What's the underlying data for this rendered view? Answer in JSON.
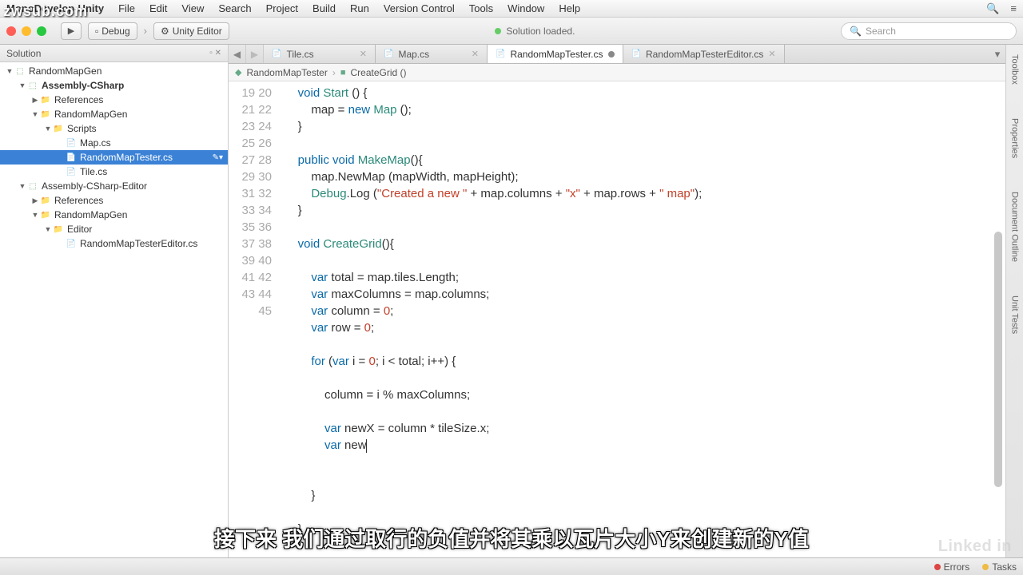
{
  "watermark": "zwsub.com",
  "menubar": {
    "title": "MonoDevelop-Unity",
    "items": [
      "File",
      "Edit",
      "View",
      "Search",
      "Project",
      "Build",
      "Run",
      "Version Control",
      "Tools",
      "Window",
      "Help"
    ]
  },
  "toolbar": {
    "debug": "Debug",
    "target": "Unity Editor",
    "status": "Solution loaded.",
    "search_placeholder": "Search"
  },
  "solution_panel": {
    "title": "Solution",
    "tree": [
      {
        "depth": 0,
        "tw": "▼",
        "icon": "proj",
        "label": "RandomMapGen"
      },
      {
        "depth": 1,
        "tw": "▼",
        "icon": "proj",
        "label": "Assembly-CSharp",
        "bold": true
      },
      {
        "depth": 2,
        "tw": "▶",
        "icon": "folder",
        "label": "References"
      },
      {
        "depth": 2,
        "tw": "▼",
        "icon": "folder",
        "label": "RandomMapGen"
      },
      {
        "depth": 3,
        "tw": "▼",
        "icon": "folder",
        "label": "Scripts"
      },
      {
        "depth": 4,
        "tw": "",
        "icon": "cs",
        "label": "Map.cs"
      },
      {
        "depth": 4,
        "tw": "",
        "icon": "cs",
        "label": "RandomMapTester.cs",
        "sel": true
      },
      {
        "depth": 4,
        "tw": "",
        "icon": "cs",
        "label": "Tile.cs"
      },
      {
        "depth": 1,
        "tw": "▼",
        "icon": "proj",
        "label": "Assembly-CSharp-Editor"
      },
      {
        "depth": 2,
        "tw": "▶",
        "icon": "folder",
        "label": "References"
      },
      {
        "depth": 2,
        "tw": "▼",
        "icon": "folder",
        "label": "RandomMapGen"
      },
      {
        "depth": 3,
        "tw": "▼",
        "icon": "folder",
        "label": "Editor"
      },
      {
        "depth": 4,
        "tw": "",
        "icon": "cs",
        "label": "RandomMapTesterEditor.cs"
      }
    ]
  },
  "tabs": [
    {
      "label": "Tile.cs",
      "close": true
    },
    {
      "label": "Map.cs",
      "close": true
    },
    {
      "label": "RandomMapTester.cs",
      "active": true,
      "modified": true
    },
    {
      "label": "RandomMapTesterEditor.cs",
      "close": true
    }
  ],
  "breadcrumb": {
    "class": "RandomMapTester",
    "method": "CreateGrid ()"
  },
  "code": {
    "first_line": 19,
    "lines": [
      {
        "n": 19,
        "html": "    <span class='kw'>void</span> <span class='ty'>Start</span> () {"
      },
      {
        "n": 20,
        "html": "        map = <span class='kw'>new</span> <span class='ty'>Map</span> ();"
      },
      {
        "n": 21,
        "html": "    }"
      },
      {
        "n": 22,
        "html": ""
      },
      {
        "n": 23,
        "html": "    <span class='kw'>public</span> <span class='kw'>void</span> <span class='ty'>MakeMap</span>(){"
      },
      {
        "n": 24,
        "html": "        map.NewMap (mapWidth, mapHeight);"
      },
      {
        "n": 25,
        "html": "        <span class='ty'>Debug</span>.Log (<span class='str'>\"Created a new \"</span> + map.columns + <span class='str'>\"x\"</span> + map.rows + <span class='str'>\" map\"</span>);"
      },
      {
        "n": 26,
        "html": "    }"
      },
      {
        "n": 27,
        "html": ""
      },
      {
        "n": 28,
        "html": "    <span class='kw'>void</span> <span class='ty'>CreateGrid</span>(){"
      },
      {
        "n": 29,
        "html": ""
      },
      {
        "n": 30,
        "html": "        <span class='kw'>var</span> total = map.tiles.Length;"
      },
      {
        "n": 31,
        "html": "        <span class='kw'>var</span> maxColumns = map.columns;"
      },
      {
        "n": 32,
        "html": "        <span class='kw'>var</span> column = <span class='num'>0</span>;"
      },
      {
        "n": 33,
        "html": "        <span class='kw'>var</span> row = <span class='num'>0</span>;"
      },
      {
        "n": 34,
        "html": ""
      },
      {
        "n": 35,
        "html": "        <span class='kw'>for</span> (<span class='kw'>var</span> i = <span class='num'>0</span>; i &lt; total; i++) {"
      },
      {
        "n": 36,
        "html": ""
      },
      {
        "n": 37,
        "html": "            column = i % maxColumns;"
      },
      {
        "n": 38,
        "html": ""
      },
      {
        "n": 39,
        "html": "            <span class='kw'>var</span> newX = column * tileSize.x;"
      },
      {
        "n": 40,
        "html": "            <span class='kw'>var</span> new<span class='caret'></span>"
      },
      {
        "n": 41,
        "html": ""
      },
      {
        "n": 42,
        "html": ""
      },
      {
        "n": 43,
        "html": "        }"
      },
      {
        "n": 44,
        "html": ""
      },
      {
        "n": 45,
        "html": "    }"
      }
    ]
  },
  "side_tabs": [
    "Toolbox",
    "Properties",
    "Document Outline",
    "Unit Tests"
  ],
  "statusbar": {
    "errors": "Errors",
    "tasks": "Tasks"
  },
  "subtitle": "接下来 我们通过取行的负值并将其乘以瓦片大小Y来创建新的Y值",
  "linkedin": "Linked in"
}
